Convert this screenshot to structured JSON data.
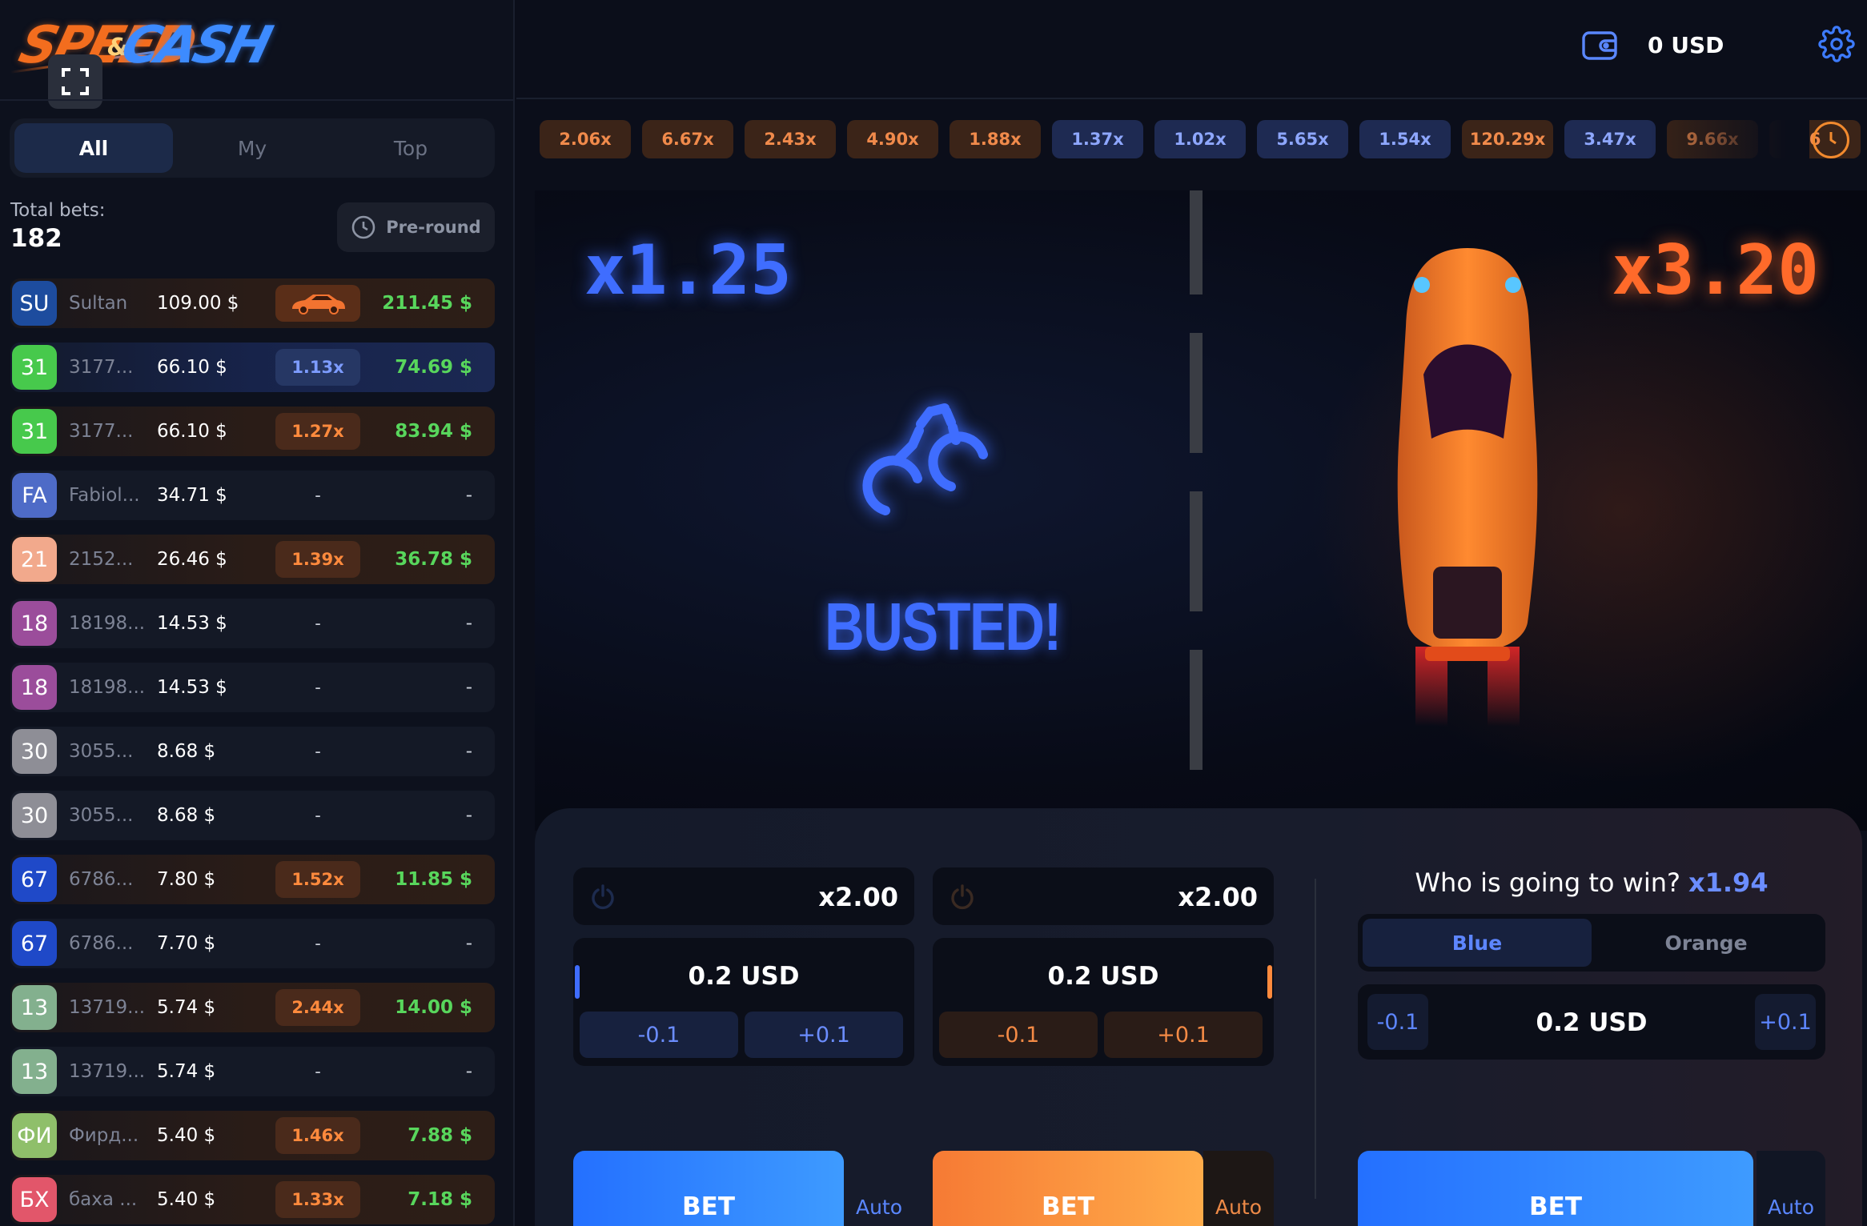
{
  "logo": {
    "word1": "SPEED",
    "amp": "&",
    "word2": "CASH"
  },
  "tabs": [
    "All",
    "My",
    "Top"
  ],
  "total_bets": {
    "label": "Total bets:",
    "value": "182"
  },
  "preround_label": "Pre-round",
  "bets": [
    {
      "avatar": "SU",
      "color": "#1d4c9e",
      "name": "Sultan",
      "amount": "109.00 $",
      "mult": "",
      "mult_type": "car",
      "win": "211.45 $",
      "row": "orange"
    },
    {
      "avatar": "31",
      "color": "#47c94c",
      "name": "3177...",
      "amount": "66.10 $",
      "mult": "1.13x",
      "mult_type": "blue",
      "win": "74.69 $",
      "row": "blue"
    },
    {
      "avatar": "31",
      "color": "#47c94c",
      "name": "3177...",
      "amount": "66.10 $",
      "mult": "1.27x",
      "mult_type": "orange",
      "win": "83.94 $",
      "row": "orange"
    },
    {
      "avatar": "FA",
      "color": "#4e6bc7",
      "name": "Fabiol...",
      "amount": "34.71 $",
      "mult": "-",
      "mult_type": "none",
      "win": "-",
      "row": "plain"
    },
    {
      "avatar": "21",
      "color": "#f2a98c",
      "name": "2152...",
      "amount": "26.46 $",
      "mult": "1.39x",
      "mult_type": "orange",
      "win": "36.78 $",
      "row": "orange"
    },
    {
      "avatar": "18",
      "color": "#9b4d9b",
      "name": "18198...",
      "amount": "14.53 $",
      "mult": "-",
      "mult_type": "none",
      "win": "-",
      "row": "plain"
    },
    {
      "avatar": "18",
      "color": "#9b4d9b",
      "name": "18198...",
      "amount": "14.53 $",
      "mult": "-",
      "mult_type": "none",
      "win": "-",
      "row": "plain"
    },
    {
      "avatar": "30",
      "color": "#8e8e96",
      "name": "3055...",
      "amount": "8.68 $",
      "mult": "-",
      "mult_type": "none",
      "win": "-",
      "row": "plain"
    },
    {
      "avatar": "30",
      "color": "#8e8e96",
      "name": "3055...",
      "amount": "8.68 $",
      "mult": "-",
      "mult_type": "none",
      "win": "-",
      "row": "plain"
    },
    {
      "avatar": "67",
      "color": "#1f49c8",
      "name": "6786...",
      "amount": "7.80 $",
      "mult": "1.52x",
      "mult_type": "orange",
      "win": "11.85 $",
      "row": "orange"
    },
    {
      "avatar": "67",
      "color": "#1f49c8",
      "name": "6786...",
      "amount": "7.70 $",
      "mult": "-",
      "mult_type": "none",
      "win": "-",
      "row": "plain"
    },
    {
      "avatar": "13",
      "color": "#83b08e",
      "name": "13719...",
      "amount": "5.74 $",
      "mult": "2.44x",
      "mult_type": "orange",
      "win": "14.00 $",
      "row": "orange"
    },
    {
      "avatar": "13",
      "color": "#83b08e",
      "name": "13719...",
      "amount": "5.74 $",
      "mult": "-",
      "mult_type": "none",
      "win": "-",
      "row": "plain"
    },
    {
      "avatar": "ФИ",
      "color": "#8fbf6a",
      "name": "Фирд...",
      "amount": "5.40 $",
      "mult": "1.46x",
      "mult_type": "orange",
      "win": "7.88 $",
      "row": "orange"
    },
    {
      "avatar": "БХ",
      "color": "#e2566a",
      "name": "баха ...",
      "amount": "5.40 $",
      "mult": "1.33x",
      "mult_type": "orange",
      "win": "7.18 $",
      "row": "orange"
    }
  ],
  "balance": "0 USD",
  "history": [
    {
      "v": "2.06x",
      "c": "o"
    },
    {
      "v": "6.67x",
      "c": "o"
    },
    {
      "v": "2.43x",
      "c": "o"
    },
    {
      "v": "4.90x",
      "c": "o"
    },
    {
      "v": "1.88x",
      "c": "o"
    },
    {
      "v": "1.37x",
      "c": "b"
    },
    {
      "v": "1.02x",
      "c": "b"
    },
    {
      "v": "5.65x",
      "c": "b"
    },
    {
      "v": "1.54x",
      "c": "b"
    },
    {
      "v": "120.29x",
      "c": "o"
    },
    {
      "v": "3.47x",
      "c": "b"
    },
    {
      "v": "9.66x",
      "c": "o"
    },
    {
      "v": "6",
      "c": "o"
    }
  ],
  "game": {
    "blue_mult": "x1.25",
    "orange_mult": "x3.20",
    "status": "BUSTED!"
  },
  "bet_blue": {
    "mult": "x2.00",
    "amount": "0.2 USD",
    "minus": "-0.1",
    "plus": "+0.1",
    "bet": "BET",
    "auto": "Auto"
  },
  "bet_orange": {
    "mult": "x2.00",
    "amount": "0.2 USD",
    "minus": "-0.1",
    "plus": "+0.1",
    "bet": "BET",
    "auto": "Auto"
  },
  "winner": {
    "title": "Who is going to win?",
    "odd": "x1.94",
    "blue": "Blue",
    "orange": "Orange",
    "minus": "-0.1",
    "plus": "+0.1",
    "amount": "0.2 USD",
    "bet": "BET",
    "auto": "Auto"
  },
  "colors": {
    "blue_accent": "#3f6dff",
    "orange_accent": "#ff6a2a",
    "win_green": "#58d65c"
  },
  "icons": [
    "fullscreen-icon",
    "history-clock-icon",
    "car-icon",
    "wallet-icon",
    "gear-icon",
    "clock-icon",
    "power-icon",
    "handcuffs-icon"
  ]
}
